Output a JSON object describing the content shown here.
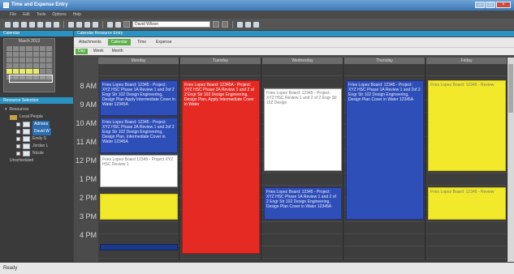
{
  "window": {
    "title": "Time and Expense Entry"
  },
  "menu": [
    "File",
    "Edit",
    "Tools",
    "Options",
    "Help"
  ],
  "toolbar": {
    "resource_value": "David Wilson"
  },
  "left": {
    "calendar_header": "Calendar",
    "calendar_title": "March 2013",
    "resources_header": "Resource Selection",
    "tree": [
      "Resources",
      "Local People",
      "Adriana",
      "David W",
      "Emily S",
      "Jordan L",
      "Nicole",
      "Unscheduled"
    ]
  },
  "main": {
    "header": "Calendar Resource Entry",
    "tabs": [
      "Attachments",
      "Calendar",
      "Time",
      "Expense"
    ],
    "subtabs": [
      "Day",
      "Week",
      "Month"
    ],
    "days": [
      "Monday",
      "Tuesday",
      "Wednesday",
      "Thursday",
      "Friday"
    ],
    "times": [
      "8 AM",
      "9 AM",
      "10 AM",
      "11 AM",
      "12 PM",
      "1 PM",
      "2 PM",
      "3 PM",
      "4 PM"
    ]
  },
  "appointments": {
    "mon1": "Fries Lopez Board: 12345 - Project: XYZ HSC Phase 1A Review 1 and 2of 2 Engr Str 102 Design Engineering, Design Plan Apply Intermediate Cover in Water 12345A",
    "mon2": "Fries Lopez Board: 12345 - Project: XYZ HSC Phase 2A Review 1 and 2of 2 Engr Str 102 Design Engineering, Design Plan, Intermediate Cover in Water 12345A",
    "mon3": "Fries Lopez Board 12345 - Project XYZ HSC Review 1",
    "tue1": "Fries Lopez Board: 12345A - Project: XYZ HSC Phase 2A Review 1 and 2 of 2 Engr Str 102 Design Engineering, Design Plan, Apply Intermediate Cover in Water",
    "wed1": "Fries Lopez Board: 12345 - Project: XYZ HSC Review 1 and 2 of 2 Engr Str 102 Design",
    "wed2": "Fries Lopez Board: 12345 - Project: XYZ HSC Phase 1A Review 1 and 2 of 2 Engr Str 102 Design Engineering, Design Plan Cover in Water 12345A",
    "thu1": "Fries Lopez Board: 12345 - Project: XYZ HSC Phase 1A Review 1 and 2of 2 Engr Str 102 Design Engineering, Design Plan Cover in Water 12345A",
    "fri1": "Fries Lopez Board: 12345 - Review",
    "fri2": "Fries Lopez Board: 12345 - Review"
  },
  "status": {
    "text": "Ready"
  },
  "colors": {
    "blue": "#2f4fb8",
    "red": "#e52a24",
    "yellow": "#f2e92a",
    "white": "#ffffff",
    "accent": "#2a93c2",
    "green": "#5bb04a"
  }
}
